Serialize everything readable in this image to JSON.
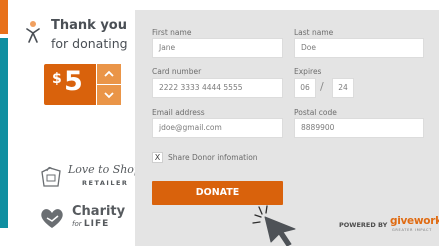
{
  "header": {
    "title": "Thank you",
    "subtitle": "for donating"
  },
  "donation": {
    "currency": "$",
    "amount": "5"
  },
  "form": {
    "first_name": {
      "label": "First name",
      "value": "Jane"
    },
    "last_name": {
      "label": "Last name",
      "value": "Doe"
    },
    "card_number": {
      "label": "Card number",
      "value": "2222 3333 4444 5555"
    },
    "expires": {
      "label": "Expires",
      "month": "06",
      "separator": "/",
      "year": "24"
    },
    "email": {
      "label": "Email address",
      "value": "jdoe@gmail.com"
    },
    "postal_code": {
      "label": "Postal code",
      "value": "8889900"
    },
    "share_donor": {
      "label": "Share Donor infomation",
      "checked": true,
      "mark": "X"
    },
    "donate_label": "DONATE"
  },
  "partners": {
    "love_to_shop": {
      "name": "Love to Shop",
      "tag": "RETAILER"
    },
    "charity_for_life": {
      "name": "Charity",
      "tag_prefix": "for",
      "tag": "LIFE"
    }
  },
  "footer": {
    "powered_by": "POWERED BY",
    "brand": "givework",
    "brand_tagline": "GREATER IMPACT"
  },
  "colors": {
    "accent_orange": "#d9620c",
    "accent_orange_light": "#ea9548",
    "teal": "#0f8fa1",
    "panel_gray": "#e4e4e4"
  },
  "icons": [
    "person-icon",
    "chevron-up-icon",
    "chevron-down-icon",
    "gift-bag-icon",
    "heart-hand-icon",
    "mouse-cursor-icon"
  ]
}
